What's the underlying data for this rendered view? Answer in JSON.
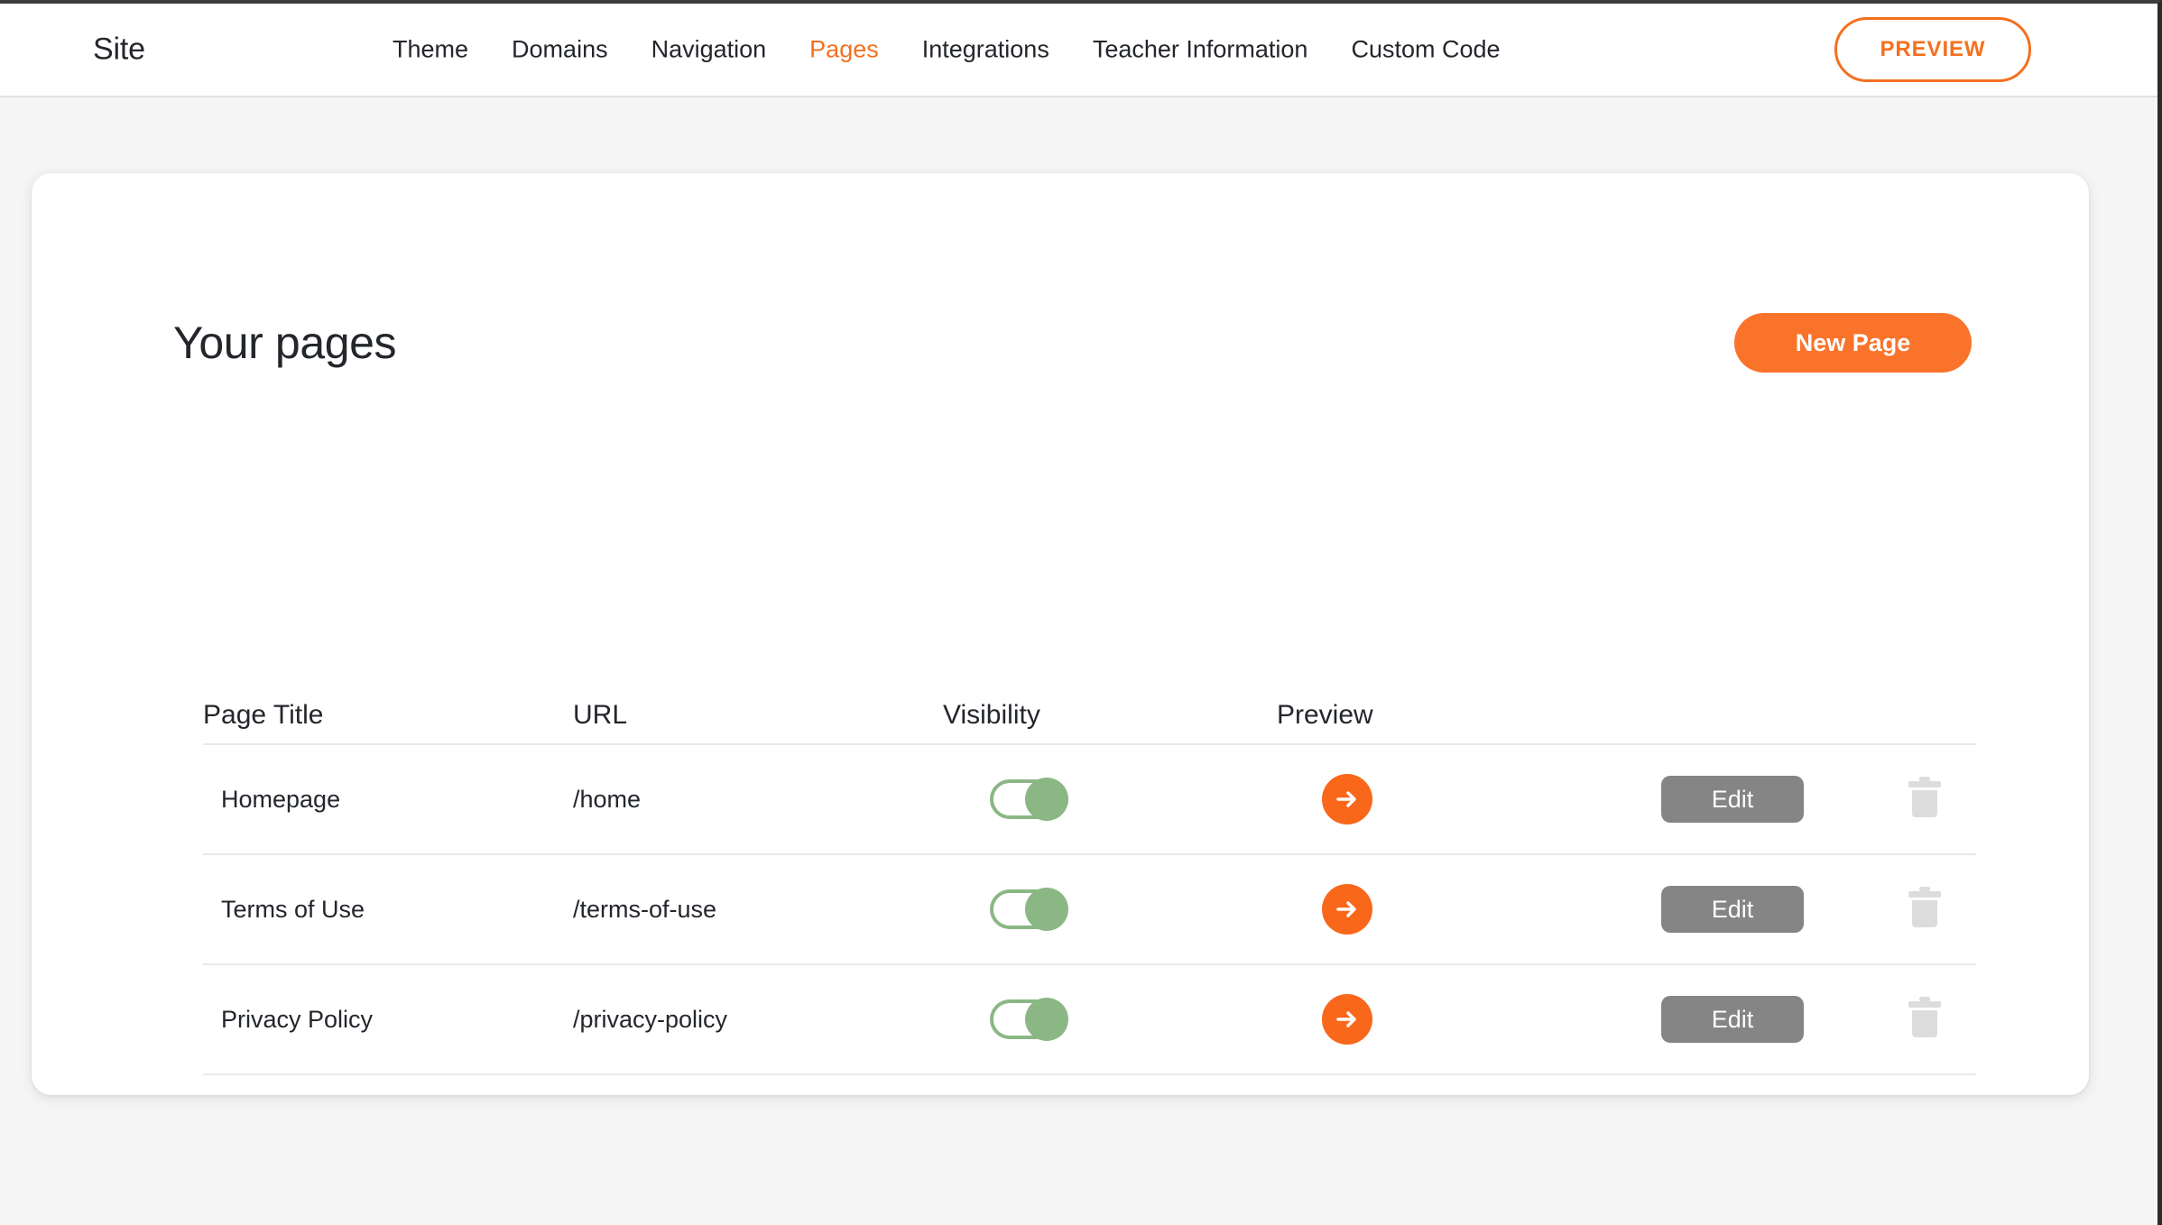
{
  "topbar": {
    "brand": "Site",
    "nav_items": [
      {
        "label": "Theme",
        "active": false
      },
      {
        "label": "Domains",
        "active": false
      },
      {
        "label": "Navigation",
        "active": false
      },
      {
        "label": "Pages",
        "active": true
      },
      {
        "label": "Integrations",
        "active": false
      },
      {
        "label": "Teacher Information",
        "active": false
      },
      {
        "label": "Custom Code",
        "active": false
      }
    ],
    "preview_label": "PREVIEW"
  },
  "main": {
    "page_title": "Your pages",
    "new_page_label": "New Page",
    "columns": {
      "title": "Page Title",
      "url": "URL",
      "visibility": "Visibility",
      "preview": "Preview"
    },
    "rows": [
      {
        "title": "Homepage",
        "url": "/home",
        "visible": true,
        "edit_label": "Edit"
      },
      {
        "title": "Terms of Use",
        "url": "/terms-of-use",
        "visible": true,
        "edit_label": "Edit"
      },
      {
        "title": "Privacy Policy",
        "url": "/privacy-policy",
        "visible": true,
        "edit_label": "Edit"
      }
    ]
  },
  "icons": {
    "preview_arrow": "arrow-right-icon",
    "delete": "trash-icon",
    "toggle": "visibility-toggle"
  },
  "colors": {
    "accent_orange": "#f9732a",
    "preview_orange": "#f4701f",
    "arrow_orange": "#f9671b",
    "toggle_green": "#8bb785",
    "edit_gray": "#858585",
    "trash_gray": "#dcdcdc",
    "page_bg": "#f5f5f5",
    "card_bg": "#ffffff",
    "text_dark": "#23262b",
    "divider": "#e6e9ec"
  }
}
